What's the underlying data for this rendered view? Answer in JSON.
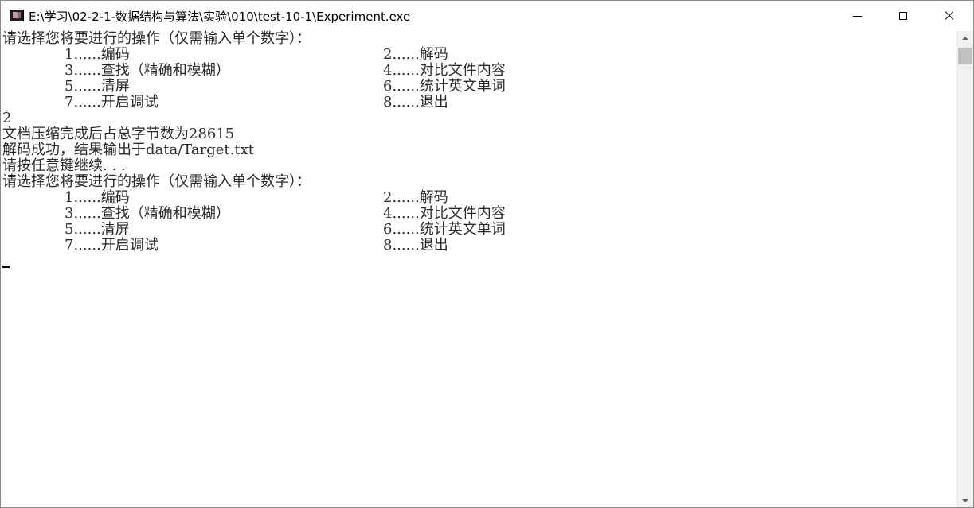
{
  "window": {
    "title": "E:\\学习\\02-2-1-数据结构与算法\\实验\\010\\test-10-1\\Experiment.exe",
    "icon": "console-app-icon",
    "buttons": [
      "minimize-icon",
      "maximize-icon",
      "close-icon"
    ]
  },
  "console": {
    "prompt": "请选择您将要进行的操作（仅需输入单个数字）：",
    "menu": [
      {
        "left": "1......编码",
        "right": "2......解码"
      },
      {
        "left": "3......查找（精确和模糊）",
        "right": "4......对比文件内容"
      },
      {
        "left": "5......清屏",
        "right": "6......统计英文单词"
      },
      {
        "left": "7......开启调试",
        "right": "8......退出"
      }
    ],
    "input_value": "2",
    "output_lines": [
      "文档压缩完成后占总字节数为28615",
      "解码成功，结果输出于data/Target.txt",
      "请按任意键继续. . ."
    ],
    "prompt_again": "请选择您将要进行的操作（仅需输入单个数字）：",
    "menu_again": [
      {
        "left": "1......编码",
        "right": "2......解码"
      },
      {
        "left": "3......查找（精确和模糊）",
        "right": "4......对比文件内容"
      },
      {
        "left": "5......清屏",
        "right": "6......统计英文单词"
      },
      {
        "left": "7......开启调试",
        "right": "8......退出"
      }
    ]
  },
  "scrollbar": {
    "position": 0
  }
}
